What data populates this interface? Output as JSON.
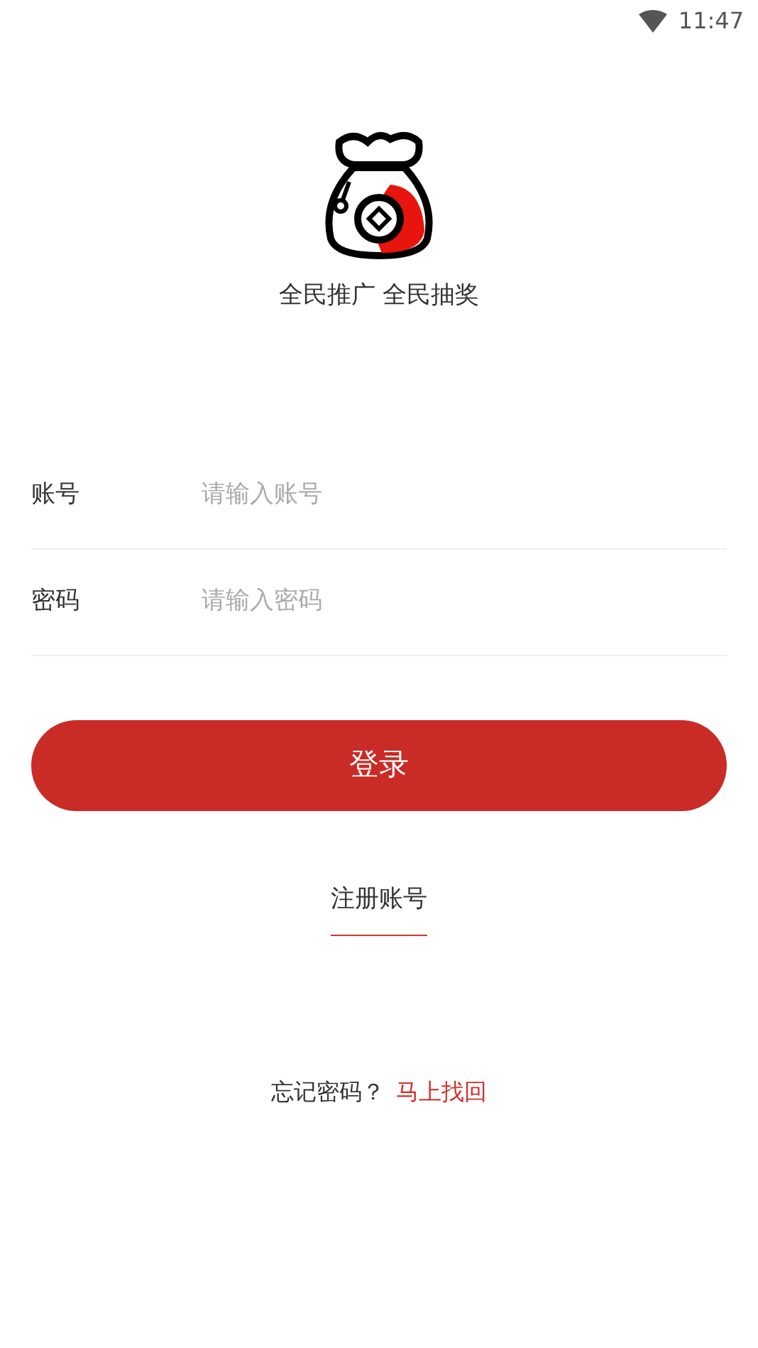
{
  "status_bar": {
    "time": "11:47"
  },
  "app": {
    "slogan": "全民推广 全民抽奖"
  },
  "form": {
    "fields": [
      {
        "label": "账号",
        "placeholder": "请输入账号"
      },
      {
        "label": "密码",
        "placeholder": "请输入密码"
      }
    ]
  },
  "login_button": "登录",
  "register_link": "注册账号",
  "forgot": {
    "text": "忘记密码？",
    "link": "马上找回"
  }
}
